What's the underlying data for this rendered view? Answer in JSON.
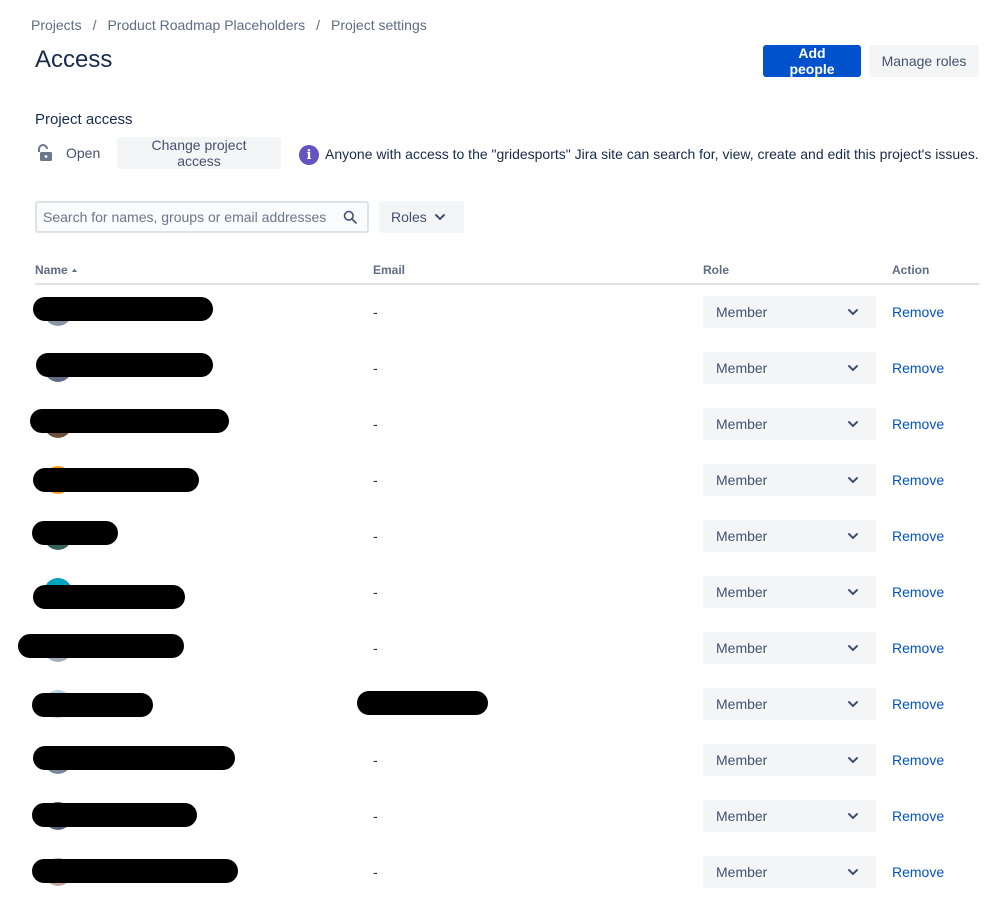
{
  "breadcrumb": [
    "Projects",
    "Product Roadmap Placeholders",
    "Project settings"
  ],
  "header": {
    "title": "Access",
    "add_people": "Add people",
    "manage_roles": "Manage roles"
  },
  "project_access": {
    "title": "Project access",
    "status": "Open",
    "change_button": "Change project access",
    "info": "Anyone with access to the \"gridesports\" Jira site can search for, view, create and edit this project's issues."
  },
  "search": {
    "placeholder": "Search for names, groups or email addresses",
    "value": ""
  },
  "roles_filter": "Roles",
  "table": {
    "headers": {
      "name": "Name",
      "email": "Email",
      "role": "Role",
      "action": "Action"
    },
    "rows": [
      {
        "email": "-",
        "role": "Member",
        "action": "Remove",
        "avatar_color": "#8993a4"
      },
      {
        "email": "-",
        "role": "Member",
        "action": "Remove",
        "avatar_color": "#5e6c84"
      },
      {
        "email": "-",
        "role": "Member",
        "action": "Remove",
        "avatar_color": "#6b4f3a"
      },
      {
        "email": "-",
        "role": "Member",
        "action": "Remove",
        "avatar_color": "#ff991f"
      },
      {
        "email": "-",
        "role": "Member",
        "action": "Remove",
        "avatar_color": "#36625a"
      },
      {
        "email": "-",
        "role": "Member",
        "action": "Remove",
        "avatar_color": "#00a3bf"
      },
      {
        "email": "-",
        "role": "Member",
        "action": "Remove",
        "avatar_color": "#a5adba"
      },
      {
        "email": "",
        "role": "Member",
        "action": "Remove",
        "avatar_color": "#b3d4e0"
      },
      {
        "email": "-",
        "role": "Member",
        "action": "Remove",
        "avatar_color": "#7a869a"
      },
      {
        "email": "-",
        "role": "Member",
        "action": "Remove",
        "avatar_color": "#505f79"
      },
      {
        "email": "-",
        "role": "Member",
        "action": "Remove",
        "avatar_color": "#c1a89a"
      }
    ]
  }
}
